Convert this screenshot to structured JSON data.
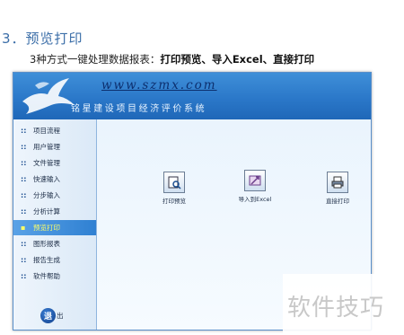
{
  "doc": {
    "heading": "3．预览打印",
    "subline_prefix": "3种方式一键处理数据报表：",
    "subline_bold": "打印预览、导入Excel、直接打印"
  },
  "app": {
    "banner_url": "www.szmx.com",
    "banner_title": "铭星建设项目经济评价系统"
  },
  "sidebar": {
    "items": [
      {
        "label": "项目流程",
        "active": false
      },
      {
        "label": "用户管理",
        "active": false
      },
      {
        "label": "文件管理",
        "active": false
      },
      {
        "label": "快速输入",
        "active": false
      },
      {
        "label": "分步输入",
        "active": false
      },
      {
        "label": "分析计算",
        "active": false
      },
      {
        "label": "预览打印",
        "active": true
      },
      {
        "label": "图形报表",
        "active": false
      },
      {
        "label": "报告生成",
        "active": false
      },
      {
        "label": "软件帮助",
        "active": false
      }
    ],
    "exit_icon_char": "退",
    "exit_label": "出"
  },
  "actions": [
    {
      "label": "打印预览",
      "icon": "print-preview-icon"
    },
    {
      "label": "导入到Excel",
      "icon": "export-excel-icon"
    },
    {
      "label": "直接打印",
      "icon": "printer-icon"
    }
  ],
  "watermark": "软件技巧"
}
